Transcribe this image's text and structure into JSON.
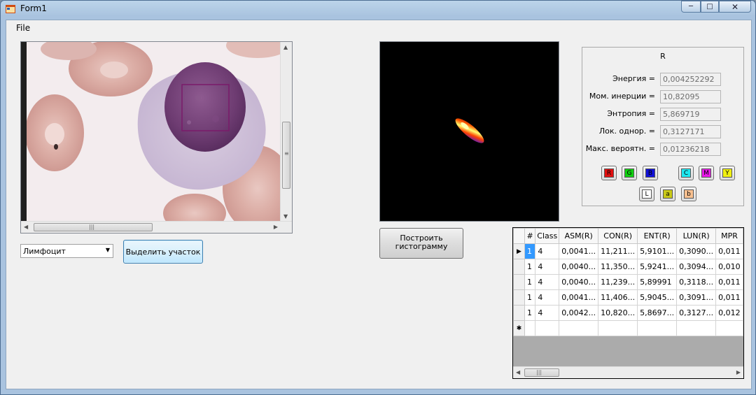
{
  "window": {
    "title": "Form1",
    "caption": {
      "minimize": "─",
      "maximize": "□",
      "close": "✕"
    }
  },
  "menu": {
    "file": "File"
  },
  "controls": {
    "class_combo_value": "Лимфоцит",
    "select_region_button": "Выделить участок",
    "build_histogram_button": "Построить гистограмму"
  },
  "features": {
    "title": "R",
    "rows": [
      {
        "label": "Энергия =",
        "value": "0,004252292"
      },
      {
        "label": "Мом. инерции =",
        "value": "10,82095"
      },
      {
        "label": "Энтропия =",
        "value": "5,869719"
      },
      {
        "label": "Лок. однор. =",
        "value": "0,3127171"
      },
      {
        "label": "Макс. вероятн. =",
        "value": "0,01236218"
      }
    ],
    "channels": [
      {
        "name": "R",
        "color": "#e01010"
      },
      {
        "name": "G",
        "color": "#10d010"
      },
      {
        "name": "B",
        "color": "#1010d8"
      },
      {
        "name": "C",
        "color": "#20e8f0"
      },
      {
        "name": "M",
        "color": "#e818e8"
      },
      {
        "name": "Y",
        "color": "#f0f010"
      },
      {
        "name": "L",
        "color": "#ffffff"
      },
      {
        "name": "a",
        "color": "#c8c818"
      },
      {
        "name": "b",
        "color": "#f8c090"
      }
    ]
  },
  "grid": {
    "columns": [
      "#",
      "Class",
      "ASM(R)",
      "CON(R)",
      "ENT(R)",
      "LUN(R)",
      "MPR"
    ],
    "rows": [
      [
        "1",
        "4",
        "0,0041...",
        "11,211...",
        "5,9101...",
        "0,3090...",
        "0,011"
      ],
      [
        "1",
        "4",
        "0,0040...",
        "11,350...",
        "5,9241...",
        "0,3094...",
        "0,010"
      ],
      [
        "1",
        "4",
        "0,0040...",
        "11,239...",
        "5,89991",
        "0,3118...",
        "0,011"
      ],
      [
        "1",
        "4",
        "0,0041...",
        "11,406...",
        "5,9045...",
        "0,3091...",
        "0,011"
      ],
      [
        "1",
        "4",
        "0,0042...",
        "10,820...",
        "5,8697...",
        "0,3127...",
        "0,012"
      ]
    ],
    "current_row_marker": "▶",
    "new_row_marker": "✱"
  },
  "colors": {
    "window_bg": "#f0f0f0",
    "selection": "#3399ff",
    "region_outline": "#7a1a6a"
  }
}
